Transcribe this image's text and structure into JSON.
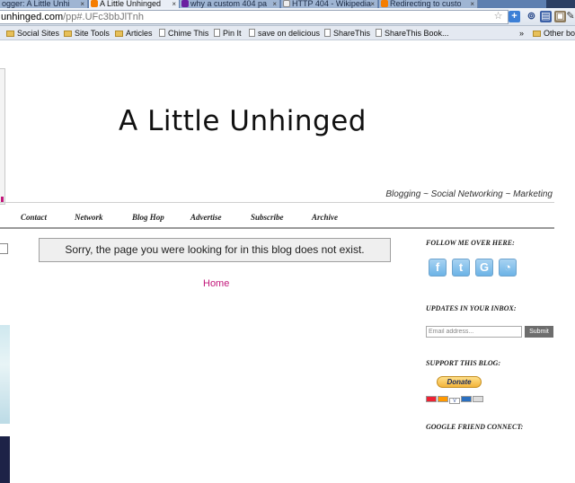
{
  "browser": {
    "tabs": [
      {
        "label": "ogger: A Little Unhi",
        "active": false,
        "favicon": "blogger-icon"
      },
      {
        "label": "A Little Unhinged",
        "active": true,
        "favicon": "blogger-icon"
      },
      {
        "label": "why a custom 404 pa",
        "active": false,
        "favicon": "yahoo-icon"
      },
      {
        "label": "HTTP 404 - Wikipedia",
        "active": false,
        "favicon": "wikipedia-icon"
      },
      {
        "label": "Redirecting to custo",
        "active": false,
        "favicon": "blogger-icon"
      }
    ],
    "close_glyph": "×",
    "url_host": "unhinged.com",
    "url_path": "/pp#.UFc3bbJlTnh",
    "other_bookmarks": "Other bo"
  },
  "bookmarks": [
    {
      "label": "Social Sites",
      "type": "folder"
    },
    {
      "label": "Site Tools",
      "type": "folder"
    },
    {
      "label": "Articles",
      "type": "folder"
    },
    {
      "label": "Chime This",
      "type": "page"
    },
    {
      "label": "Pin It",
      "type": "page"
    },
    {
      "label": "save on delicious",
      "type": "page"
    },
    {
      "label": "ShareThis",
      "type": "page"
    },
    {
      "label": "ShareThis Book...",
      "type": "page"
    }
  ],
  "blog": {
    "title": "A Little Unhinged",
    "tagline": "Blogging ~ Social Networking ~ Marketing",
    "nav": [
      "Contact",
      "Network",
      "Blog Hop",
      "Advertise",
      "Subscribe",
      "Archive"
    ],
    "notfound_message": "Sorry, the page you were looking for in this blog does not exist.",
    "home_link": "Home"
  },
  "sidebar": {
    "follow_heading": "FOLLOW ME OVER HERE:",
    "social_icons": [
      "facebook-icon",
      "twitter-icon",
      "google-icon",
      "rss-icon"
    ],
    "updates_heading": "UPDATES IN YOUR INBOX:",
    "email_placeholder": "Email address...",
    "submit_label": "Submit",
    "support_heading": "SUPPORT THIS BLOG:",
    "donate_label": "Donate",
    "gfc_heading": "GOOGLE FRIEND CONNECT:"
  },
  "colors": {
    "accent_link": "#c2177a",
    "tab_strip": "#5d7fb0"
  }
}
